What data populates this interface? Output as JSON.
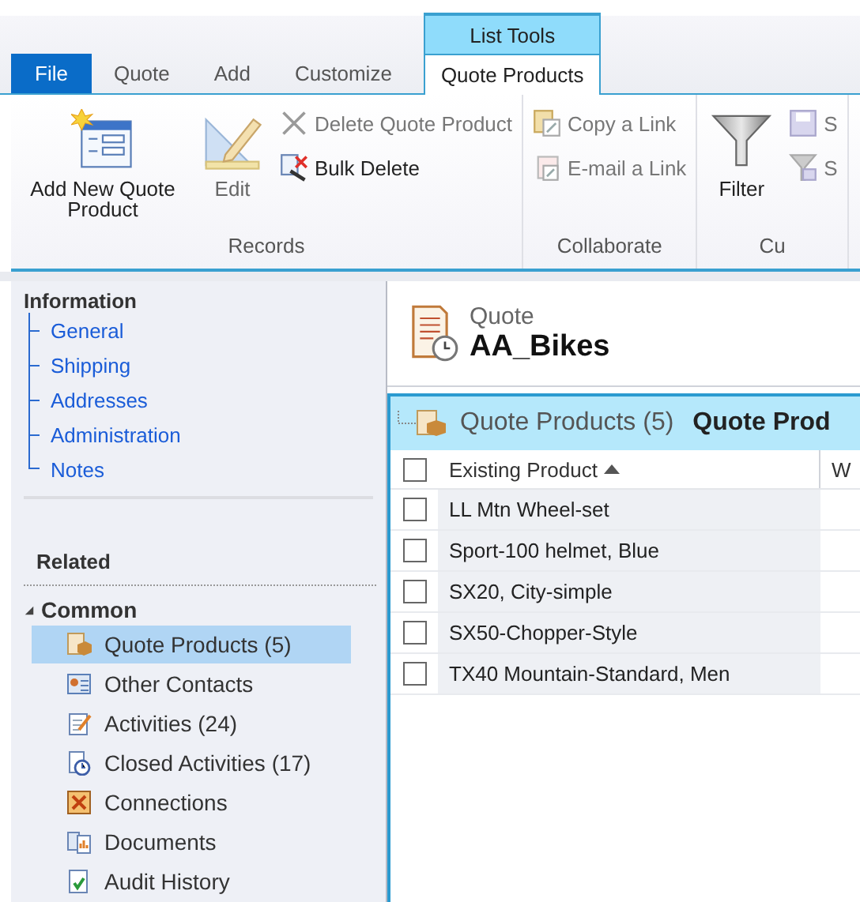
{
  "ribbon": {
    "context_label": "List Tools",
    "tabs": [
      {
        "label": "File",
        "kind": "file",
        "selected": false,
        "contextual": false
      },
      {
        "label": "Quote",
        "kind": "tab",
        "selected": false,
        "contextual": false
      },
      {
        "label": "Add",
        "kind": "tab",
        "selected": false,
        "contextual": false
      },
      {
        "label": "Customize",
        "kind": "tab",
        "selected": false,
        "contextual": false
      },
      {
        "label": "Quote Products",
        "kind": "tab",
        "selected": true,
        "contextual": true
      }
    ],
    "groups": [
      {
        "label": "Records",
        "buttons": [
          {
            "label": "Add New Quote Product",
            "kind": "large",
            "disabled": false
          },
          {
            "label": "Edit",
            "kind": "large",
            "disabled": true
          },
          {
            "label": "Delete Quote Product",
            "kind": "small",
            "disabled": true
          },
          {
            "label": "Bulk Delete",
            "kind": "small",
            "disabled": false
          }
        ]
      },
      {
        "label": "Collaborate",
        "buttons": [
          {
            "label": "Copy a Link",
            "kind": "small",
            "disabled": true
          },
          {
            "label": "E-mail a Link",
            "kind": "small",
            "disabled": true
          }
        ]
      },
      {
        "label": "Cu",
        "buttons": [
          {
            "label": "Filter",
            "kind": "large",
            "disabled": false
          },
          {
            "label": "S",
            "kind": "small",
            "disabled": true
          },
          {
            "label": "S",
            "kind": "small",
            "disabled": true
          }
        ]
      }
    ]
  },
  "nav": {
    "information": {
      "title": "Information",
      "items": [
        "General",
        "Shipping",
        "Addresses",
        "Administration",
        "Notes"
      ]
    },
    "related": {
      "title": "Related",
      "section": {
        "label": "Common",
        "expanded": true,
        "items": [
          {
            "label": "Quote Products (5)",
            "selected": true
          },
          {
            "label": "Other Contacts",
            "selected": false
          },
          {
            "label": "Activities (24)",
            "selected": false
          },
          {
            "label": "Closed Activities (17)",
            "selected": false
          },
          {
            "label": "Connections",
            "selected": false
          },
          {
            "label": "Documents",
            "selected": false
          },
          {
            "label": "Audit History",
            "selected": false
          }
        ]
      }
    }
  },
  "record": {
    "entity": "Quote",
    "name": "AA_Bikes"
  },
  "grid": {
    "title": "Quote Products (5)",
    "view": "Quote Prod",
    "all_checked": false,
    "columns": [
      {
        "label": "Existing Product",
        "sorted": true
      },
      {
        "label": "W",
        "sorted": false
      }
    ],
    "rows": [
      {
        "product": "LL Mtn Wheel-set",
        "checked": false
      },
      {
        "product": "Sport-100 helmet, Blue",
        "checked": false
      },
      {
        "product": "SX20, City-simple",
        "checked": false
      },
      {
        "product": "SX50-Chopper-Style",
        "checked": false
      },
      {
        "product": "TX40 Mountain-Standard, Men",
        "checked": false
      }
    ]
  }
}
